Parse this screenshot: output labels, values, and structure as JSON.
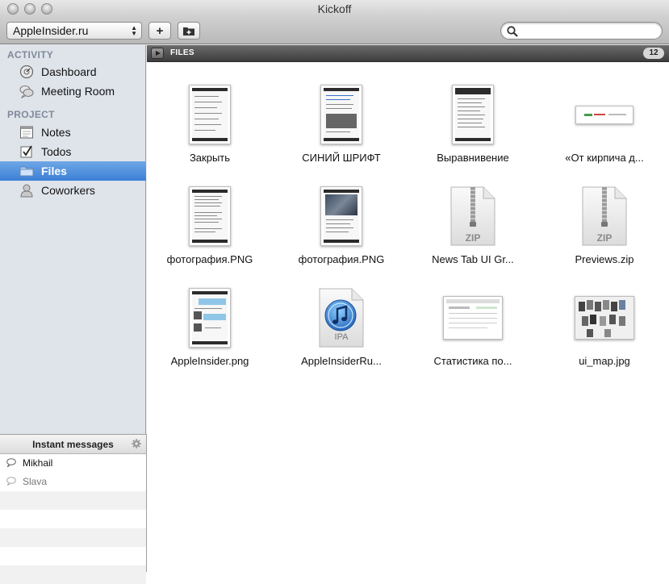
{
  "window": {
    "title": "Kickoff"
  },
  "toolbar": {
    "project_select": "AppleInsider.ru",
    "add_label": "+",
    "search_placeholder": ""
  },
  "sidebar": {
    "activity_header": "ACTIVITY",
    "activity_items": [
      {
        "label": "Dashboard",
        "icon": "dashboard-icon"
      },
      {
        "label": "Meeting Room",
        "icon": "chat-bubbles-icon"
      }
    ],
    "project_header": "PROJECT",
    "project_items": [
      {
        "label": "Notes",
        "icon": "notes-icon"
      },
      {
        "label": "Todos",
        "icon": "checkbox-icon"
      },
      {
        "label": "Files",
        "icon": "folder-icon",
        "active": true
      },
      {
        "label": "Coworkers",
        "icon": "person-icon"
      }
    ]
  },
  "instant_messages": {
    "title": "Instant messages",
    "contacts": [
      {
        "name": "Mikhail",
        "online": true
      },
      {
        "name": "Slava",
        "online": false
      }
    ]
  },
  "files": {
    "section_label": "FILES",
    "count": "12",
    "items": [
      {
        "name": "Закрыть",
        "kind": "phone-screenshot"
      },
      {
        "name": "СИНИЙ ШРИФТ",
        "kind": "phone-screenshot"
      },
      {
        "name": "Выравнивение",
        "kind": "phone-screenshot"
      },
      {
        "name": "«От кирпича д...",
        "kind": "wide-screenshot"
      },
      {
        "name": "фотография.PNG",
        "kind": "phone-screenshot"
      },
      {
        "name": "фотография.PNG",
        "kind": "phone-screenshot"
      },
      {
        "name": "News Tab UI Gr...",
        "kind": "zip",
        "badge": "ZIP"
      },
      {
        "name": "Previews.zip",
        "kind": "zip",
        "badge": "ZIP"
      },
      {
        "name": "AppleInsider.png",
        "kind": "phone-screenshot"
      },
      {
        "name": "AppleInsiderRu...",
        "kind": "ipa",
        "badge": "IPA"
      },
      {
        "name": "Статистика по...",
        "kind": "wide-screenshot"
      },
      {
        "name": "ui_map.jpg",
        "kind": "wide-screenshot"
      }
    ]
  },
  "colors": {
    "selection": "#3c7fd6",
    "sidebar_bg": "#dfe4eb",
    "section_header": "#7f8a99"
  }
}
